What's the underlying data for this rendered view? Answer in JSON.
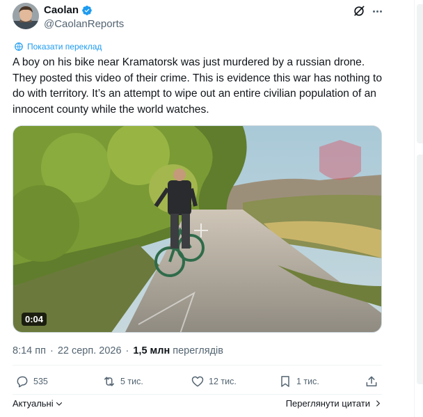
{
  "author": {
    "display_name": "Caolan",
    "handle": "@CaolanReports"
  },
  "translate_label": "Показати переклад",
  "tweet_text": "A boy on his bike near Kramatorsk was just murdered by a russian drone. They posted this video of their crime. This is evidence this war has nothing to do with territory. It’s an attempt to wipe out an entire civilian population of an innocent county while the world watches.",
  "media": {
    "duration": "0:04"
  },
  "meta": {
    "time": "8:14 пп",
    "date": "22 серп. 2026",
    "separator": "·",
    "views_count": "1,5 млн",
    "views_label": "переглядів"
  },
  "actions": {
    "replies": "535",
    "reposts": "5 тис.",
    "likes": "12 тис.",
    "bookmarks": "1 тис."
  },
  "footer": {
    "sort_label": "Актуальні",
    "quotes_label": "Переглянути цитати"
  },
  "colors": {
    "accent": "#1d9bf0",
    "text_primary": "#0f1419",
    "text_secondary": "#536471"
  }
}
